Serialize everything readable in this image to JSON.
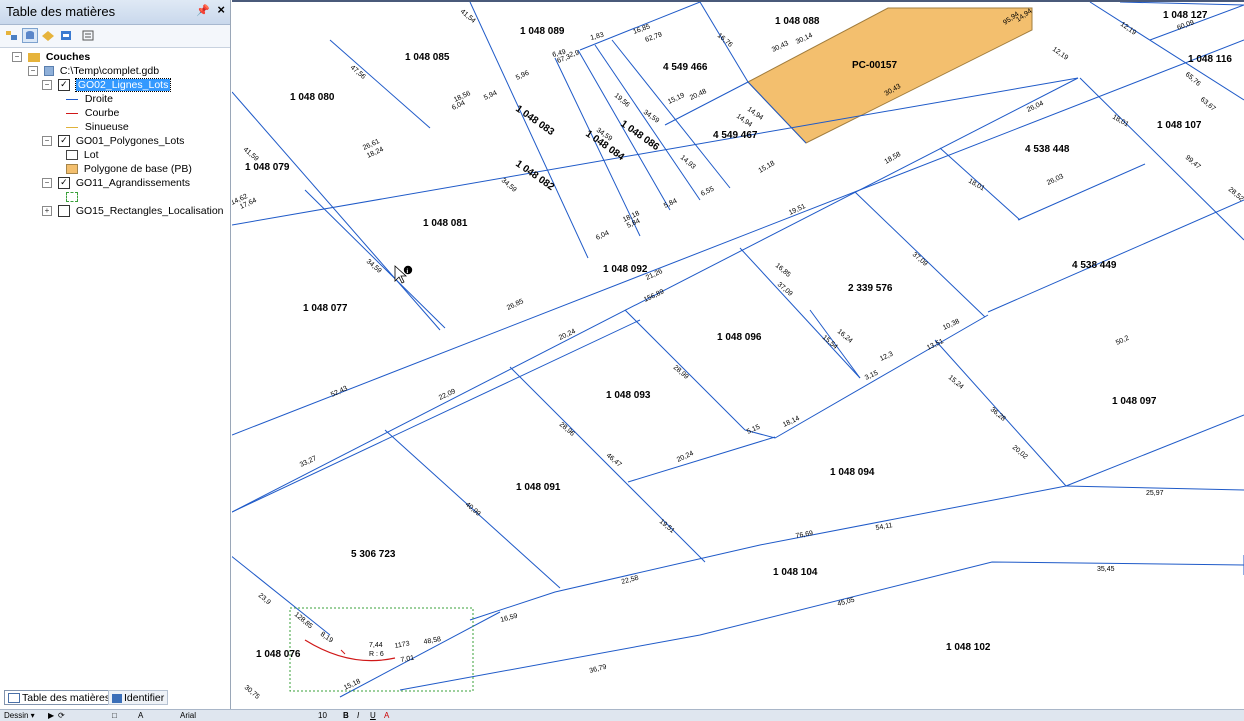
{
  "toc": {
    "title": "Table des matières",
    "pin_glyph": " ᵽ",
    "close_glyph": "×",
    "layers_root": "Couches",
    "database": "C:\\Temp\\complet.gdb",
    "lines_layer": {
      "name": "GO02_Lignes_Lots",
      "legend": [
        {
          "label": "Droite",
          "color": "#1f5ac8"
        },
        {
          "label": "Courbe",
          "color": "#d01818"
        },
        {
          "label": "Sinueuse",
          "color": "#e0b23a"
        }
      ]
    },
    "polygons_layer": {
      "name": "GO01_Polygones_Lots",
      "legend": [
        {
          "label": "Lot",
          "color": "#ffffff"
        },
        {
          "label": "Polygone de base (PB)",
          "color": "#f3bf6e"
        }
      ]
    },
    "enlargements_layer": {
      "name": "GO11_Agrandissements"
    },
    "rectangles_layer": {
      "name": "GO15_Rectangles_Localisation"
    },
    "tabs": {
      "toc": "Table des matières",
      "identify": "Identifier"
    }
  },
  "draw_toolbar": {
    "dessin": "Dessin ▾",
    "font": "Arial",
    "size": "10",
    "bold": "B",
    "italic": "I",
    "underline": "U",
    "font_color": "A"
  },
  "map": {
    "highlight_color": "#f3bf6e",
    "line_color": "#1f5ac8",
    "lots": [
      {
        "id": "l1",
        "label": "1 048 089"
      },
      {
        "id": "l2",
        "label": "1 048 088"
      },
      {
        "id": "l3",
        "label": "1 048 127"
      },
      {
        "id": "l4",
        "label": "1 048 116"
      },
      {
        "id": "l5",
        "label": "1 048 085"
      },
      {
        "id": "l6",
        "label": "4 549 466"
      },
      {
        "id": "l7",
        "label": "PC-00157"
      },
      {
        "id": "l8",
        "label": "1 048 080"
      },
      {
        "id": "l9",
        "label": "1 048 083"
      },
      {
        "id": "l10",
        "label": "1 048 086"
      },
      {
        "id": "l11",
        "label": "4 549 467"
      },
      {
        "id": "l12",
        "label": "1 048 107"
      },
      {
        "id": "l13",
        "label": "1 048 084"
      },
      {
        "id": "l14",
        "label": "4 538 448"
      },
      {
        "id": "l15",
        "label": "1 048 079"
      },
      {
        "id": "l16",
        "label": "1 048 082"
      },
      {
        "id": "l17",
        "label": "1 048 081"
      },
      {
        "id": "l18",
        "label": "1 048 092"
      },
      {
        "id": "l19",
        "label": "4 538 449"
      },
      {
        "id": "l20",
        "label": "2 339 576"
      },
      {
        "id": "l21",
        "label": "1 048 077"
      },
      {
        "id": "l22",
        "label": "1 048 096"
      },
      {
        "id": "l23",
        "label": "1 048 093"
      },
      {
        "id": "l24",
        "label": "1 048 097"
      },
      {
        "id": "l25",
        "label": "1 048 094"
      },
      {
        "id": "l26",
        "label": "1 048 091"
      },
      {
        "id": "l27",
        "label": "5 306 723"
      },
      {
        "id": "l28",
        "label": "1 048 104"
      },
      {
        "id": "l29",
        "label": "1 048 076"
      },
      {
        "id": "l30",
        "label": "1 048 102"
      }
    ],
    "dimensions": [
      "14,94",
      "95,94",
      "12,19",
      "60,09",
      "12,19",
      "65,76",
      "63,67",
      "41,54",
      "1,83",
      "6,49",
      "2,9",
      "16,85",
      "62,79",
      "16,76",
      "30,43",
      "30,14",
      "47,56",
      "6,04",
      "5,94",
      "5,96",
      "67,3",
      "19,56",
      "15,19",
      "20,48",
      "30,43",
      "18,01",
      "26,04",
      "14,94",
      "14,94",
      "41,59",
      "26,61",
      "18,24",
      "18,56",
      "34,59",
      "34,59",
      "14,93",
      "15,18",
      "18,58",
      "18,01",
      "26,03",
      "99,47",
      "28,52",
      "14,62",
      "17,64",
      "34,59",
      "6,55",
      "5,84",
      "18,18",
      "5,84",
      "6,04",
      "19,51",
      "37,09",
      "34,59",
      "21,26",
      "156,89",
      "16,85",
      "37,09",
      "26,85",
      "16,24",
      "15,54",
      "10,38",
      "13,51",
      "12,3",
      "3,15",
      "50,2",
      "20,24",
      "28,99",
      "18,14",
      "15,24",
      "52,43",
      "22,09",
      "28,96",
      "5,15",
      "36,28",
      "20,02",
      "46,47",
      "20,24",
      "33,27",
      "40,99",
      "19,51",
      "25,97",
      "76,69",
      "54,11",
      "23,9",
      "128,85",
      "8,19",
      "22,58",
      "16,59",
      "35,45",
      "45,05",
      "30,75",
      "7,44",
      "R : 6",
      "1173",
      "48,58",
      "7,01",
      "36,79",
      "15,18"
    ]
  }
}
